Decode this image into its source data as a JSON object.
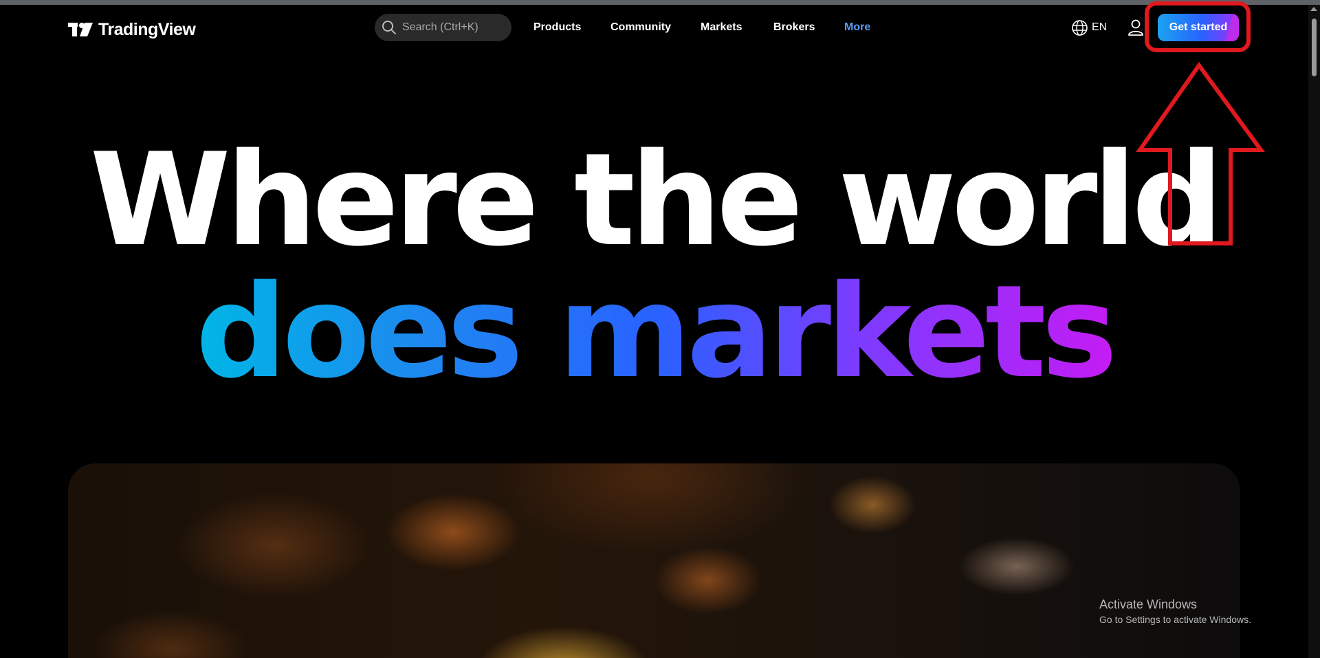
{
  "header": {
    "logo_text": "TradingView",
    "search_placeholder": "Search (Ctrl+K)",
    "nav": {
      "products": "Products",
      "community": "Community",
      "markets": "Markets",
      "brokers": "Brokers",
      "more": "More"
    },
    "language": "EN",
    "cta_label": "Get started"
  },
  "hero": {
    "line1": "Where the world",
    "line2": "does markets"
  },
  "os_watermark": {
    "title": "Activate Windows",
    "subtitle": "Go to Settings to activate Windows."
  },
  "icons": [
    "tradingview-logo-icon",
    "search-icon",
    "globe-icon",
    "user-icon",
    "annotation-arrow-icon"
  ],
  "colors": {
    "background": "#000000",
    "more_link": "#5b9cf6",
    "annotation": "#e0191f",
    "cta_gradient_start": "#1ba2f0",
    "cta_gradient_end": "#a32cf8"
  }
}
